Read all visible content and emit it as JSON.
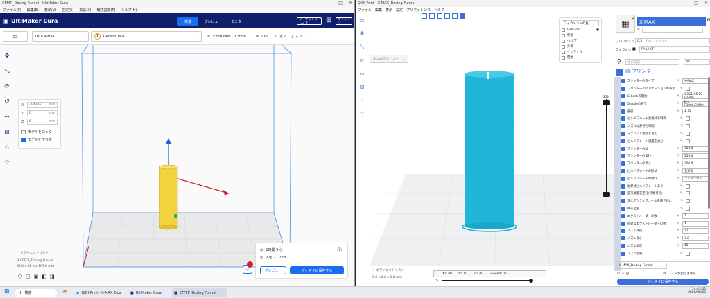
{
  "cura": {
    "title": "CFFFP_Dosing Funnel - UltiMaker Cura",
    "menu": [
      "ファイル(F)",
      "編集(E)",
      "表示(V)",
      "設定(S)",
      "拡張(X)",
      "環境設定(P)",
      "ヘルプ(H)"
    ],
    "logo": "UltiMaker Cura",
    "stages": [
      "準備",
      "プレビュー",
      "モニター"
    ],
    "marketplace": "マーケットプレイス",
    "signin": "サインイン",
    "printer": "QIDI X-Max",
    "material": "Generic PLA",
    "profile": "Extra Fast - 0.3mm",
    "infill": "20%",
    "support": "オフ",
    "adhesion": "オフ",
    "move": {
      "x_label": "X",
      "x": "-0.4316",
      "y_label": "Y",
      "y": "0",
      "z_label": "Z",
      "z": "0",
      "unit": "mm"
    },
    "lock_model": "モデルをロック",
    "drop_model": "モデルを下ろす",
    "object_list": "オブジェクトリスト",
    "object_name": "CFFFP_Dosing Funnel",
    "object_dims": "38.0 x 38.0 x 107.6 mm",
    "print_time": "1時間 9分",
    "print_material": "22g · 7.23m",
    "preview_btn": "プレビュー",
    "save_btn": "ディスクに保存する",
    "notif_count": "1"
  },
  "qidi": {
    "title": "QIDI Print - X-MAX_Dosing Funnel",
    "menu": [
      "ファイル",
      "編集",
      "表示",
      "設定",
      "プリファレンス",
      "ヘルプ"
    ],
    "view_select": "Gcodeプレビュー",
    "legend_title": "フィラメントの色",
    "legend": [
      "Extruder",
      "移動",
      "ヘルプ",
      "外側",
      "インフィル",
      "開始"
    ],
    "printer_name": "X-MAX",
    "ip_label": "IP:",
    "profile_label": "プロファイル",
    "profile_value": "0.3",
    "profile_hint": "Fast - 0.3mm",
    "filament_label": "フィラメント",
    "filament_value": "PA12-CF",
    "search_placeholder": "検索設定",
    "search_scope": "All",
    "section": "プリンター",
    "settings": [
      {
        "label": "プリンターのタイプ",
        "value": "X-MAX"
      },
      {
        "label": "プリンターのバリエーションの表示",
        "value": ""
      },
      {
        "label": "G-Codeの開始",
        "value": "G0G1 X5 E0 F2400"
      },
      {
        "label": "G-codeの終了",
        "value": "E-3 F3000;G0H94"
      },
      {
        "label": "直径",
        "value": "1.75"
      },
      {
        "label": "ビルドプレート加熱待ち時間",
        "value": ""
      },
      {
        "label": "ノズル加熱待ち時間",
        "value": ""
      },
      {
        "label": "マテリアル温度を含む",
        "value": ""
      },
      {
        "label": "ビルドプレート温度を含む",
        "value": ""
      },
      {
        "label": "プリンターの幅",
        "value": "300.0"
      },
      {
        "label": "プリンターの奥行",
        "value": "250.0"
      },
      {
        "label": "プリンターの高さ",
        "value": "300.0"
      },
      {
        "label": "ビルドプレートの形状",
        "value": "長方形"
      },
      {
        "label": "ビルドプレートの材料",
        "value": "アルミニウム"
      },
      {
        "label": "加熱式ビルドプレートあり",
        "value": ""
      },
      {
        "label": "造形温度安定化(待機待ち)",
        "value": ""
      },
      {
        "label": "常にアクティブ…ールを書き込む",
        "value": ""
      },
      {
        "label": "中心位置",
        "value": ""
      },
      {
        "label": "エクストルーダーの数",
        "value": "1"
      },
      {
        "label": "有効なエクストルーダーの数",
        "value": "1"
      },
      {
        "label": "ノズル外径",
        "value": "1.0"
      },
      {
        "label": "ノズル長さ",
        "value": "3.0"
      },
      {
        "label": "ノズル角度",
        "value": "45"
      },
      {
        "label": "ノズル加熱…",
        "value": ""
      }
    ],
    "job_name": "X-MAX_Dosing Funnel",
    "print_time": "47分",
    "cost": "コスト予測付ません",
    "save_btn": "ディスクに保存する",
    "object_list": "オブジェクトリスト",
    "object_dims": "0.0 x 0.0 x 0.0 mm",
    "readout": {
      "x": "X:0.00",
      "y": "Y:0.00",
      "z": "Z:0.00",
      "speed": "Speed:0.00"
    },
    "layer_top": "359"
  },
  "taskbar": {
    "search": "検索",
    "apps": [
      "QIDI Print - X-MAX_Dos",
      "UltiMaker Cura",
      "CFFFP_Dosing Funnel -"
    ],
    "time": "14:43:50",
    "date": "2026/08/20"
  },
  "colors": {
    "cura_header": "#0f1f6b",
    "cura_blue": "#196ef0",
    "model_yellow": "#f3d33f",
    "qidi_model": "#1fb6d9"
  }
}
